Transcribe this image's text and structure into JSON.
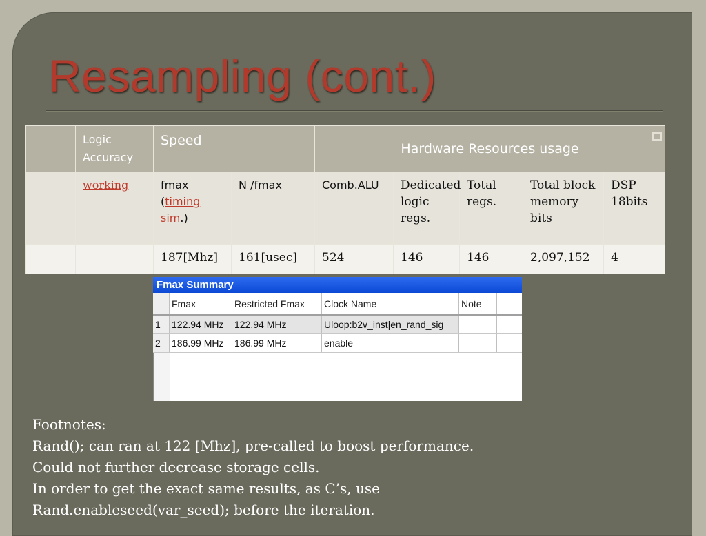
{
  "title": "Resampling (cont.)",
  "table": {
    "header": {
      "logic_accuracy": "Logic Accuracy",
      "speed": "Speed",
      "hardware": "Hardware Resources usage"
    },
    "row2": {
      "working": "working",
      "fmax": "fmax",
      "timing_sim": "timing sim",
      "n_fmax": "N /fmax",
      "comb_alu": "Comb.ALU",
      "dedicated": "Dedicated logic regs.",
      "total_regs": "Total regs.",
      "total_block": "Total block memory bits",
      "dsp": "DSP 18bits"
    },
    "row3": {
      "fmax_val": "187[Mhz]",
      "n_fmax_val": "161[usec]",
      "comb_alu_val": "524",
      "dedicated_val": "146",
      "total_regs_val": "146",
      "total_block_val": "2,097,152",
      "dsp_val": "4"
    }
  },
  "fmax_summary": {
    "title": "Fmax Summary",
    "columns": [
      "Fmax",
      "Restricted Fmax",
      "Clock Name",
      "Note"
    ],
    "rows": [
      {
        "num": "1",
        "fmax": "122.94 MHz",
        "restricted": "122.94 MHz",
        "clock": "Uloop:b2v_inst|en_rand_sig",
        "note": ""
      },
      {
        "num": "2",
        "fmax": "186.99 MHz",
        "restricted": "186.99 MHz",
        "clock": "enable",
        "note": ""
      }
    ]
  },
  "footnotes": {
    "heading": "Footnotes:",
    "lines": [
      "Rand(); can ran at 122 [Mhz], pre-called to boost performance.",
      "Could not further decrease storage cells.",
      "In order to get the exact same results, as C’s, use",
      "Rand.enableseed(var_seed); before the iteration."
    ]
  }
}
